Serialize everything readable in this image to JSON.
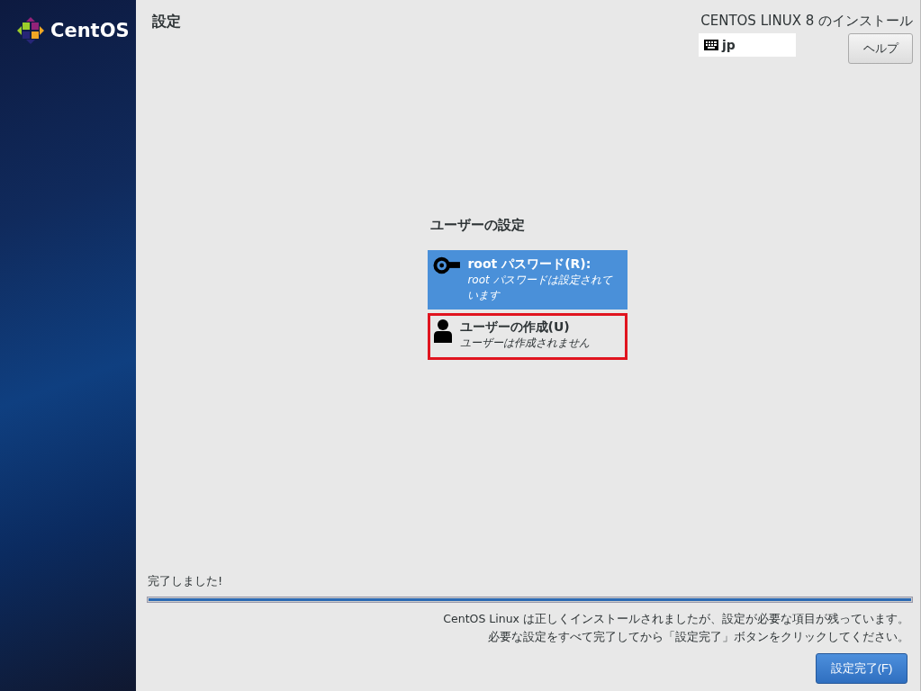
{
  "sidebar": {
    "logo_text": "CentOS"
  },
  "header": {
    "title": "設定",
    "product": "CENTOS LINUX 8 のインストール",
    "keyboard": "jp",
    "help_button": "ヘルプ"
  },
  "section": {
    "title": "ユーザーの設定",
    "spokes": [
      {
        "kind": "key",
        "title": "root パスワード(R):",
        "status": "root パスワードは設定されています",
        "selected": true,
        "highlighted": false
      },
      {
        "kind": "user",
        "title": "ユーザーの作成(U)",
        "status": "ユーザーは作成されません",
        "selected": false,
        "highlighted": true
      }
    ]
  },
  "progress": {
    "label": "完了しました!",
    "level": 1
  },
  "messages": [
    "CentOS Linux は正しくインストールされましたが、設定が必要な項目が残っています。",
    "必要な設定をすべて完了してから「設定完了」ボタンをクリックしてください。"
  ],
  "finish_button": "設定完了(F)"
}
